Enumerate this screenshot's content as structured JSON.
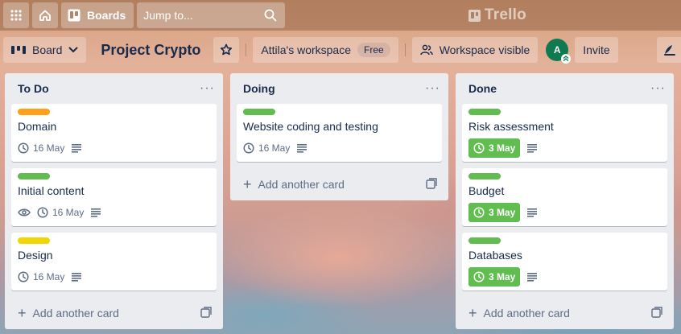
{
  "topbar": {
    "boards_label": "Boards",
    "search_placeholder": "Jump to...",
    "logo_text": "Trello"
  },
  "boardbar": {
    "view_label": "Board",
    "title": "Project Crypto",
    "workspace_label": "Attila's workspace",
    "plan_badge": "Free",
    "visibility_label": "Workspace visible",
    "avatar_initial": "A",
    "invite_label": "Invite"
  },
  "colors": {
    "orange": "#ff9f1a",
    "green": "#61bd4f",
    "yellow": "#f2d600"
  },
  "lists": [
    {
      "title": "To Do",
      "add_label": "Add another card",
      "cards": [
        {
          "label_color": "#ff9f1a",
          "title": "Domain",
          "watch": false,
          "date": "16 May",
          "date_done": false,
          "description": true
        },
        {
          "label_color": "#61bd4f",
          "title": "Initial content",
          "watch": true,
          "date": "16 May",
          "date_done": false,
          "description": true
        },
        {
          "label_color": "#f2d600",
          "title": "Design",
          "watch": false,
          "date": "16 May",
          "date_done": false,
          "description": true
        }
      ]
    },
    {
      "title": "Doing",
      "add_label": "Add another card",
      "cards": [
        {
          "label_color": "#61bd4f",
          "title": "Website coding and testing",
          "watch": false,
          "date": "16 May",
          "date_done": false,
          "description": true
        }
      ]
    },
    {
      "title": "Done",
      "add_label": "Add another card",
      "cards": [
        {
          "label_color": "#61bd4f",
          "title": "Risk assessment",
          "watch": false,
          "date": "3 May",
          "date_done": true,
          "description": true
        },
        {
          "label_color": "#61bd4f",
          "title": "Budget",
          "watch": false,
          "date": "3 May",
          "date_done": true,
          "description": true
        },
        {
          "label_color": "#61bd4f",
          "title": "Databases",
          "watch": false,
          "date": "3 May",
          "date_done": true,
          "description": true
        }
      ]
    }
  ]
}
